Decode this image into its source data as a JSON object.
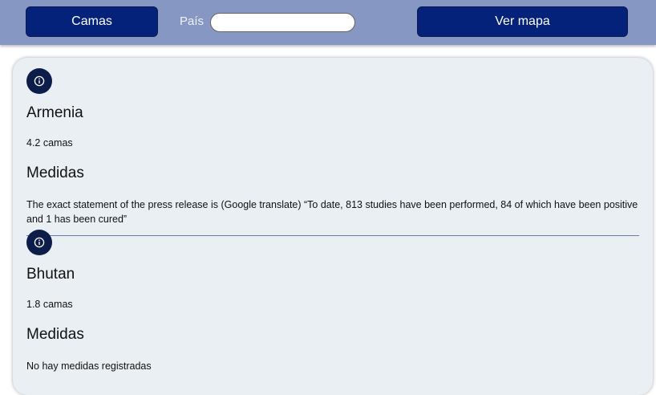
{
  "header": {
    "camas_button": "Camas",
    "pais_label": "País",
    "pais_input_value": "",
    "map_button": "Ver mapa"
  },
  "entries": [
    {
      "country": "Armenia",
      "camas": "4.2 camas",
      "medidas_title": "Medidas",
      "medidas_text": "The exact statement of the press release is (Google translate) “To date, 813 studies have been performed, 84 of which have been positive and 1 has been cured”"
    },
    {
      "country": "Bhutan",
      "camas": "1.8 camas",
      "medidas_title": "Medidas",
      "medidas_text": "No hay medidas registradas"
    }
  ],
  "icons": {
    "info": "info-icon"
  },
  "colors": {
    "header_bg": "#8797c3",
    "button_bg": "#04227a",
    "panel_bg": "#eaeff3",
    "icon_bg": "#0d1d4a"
  }
}
